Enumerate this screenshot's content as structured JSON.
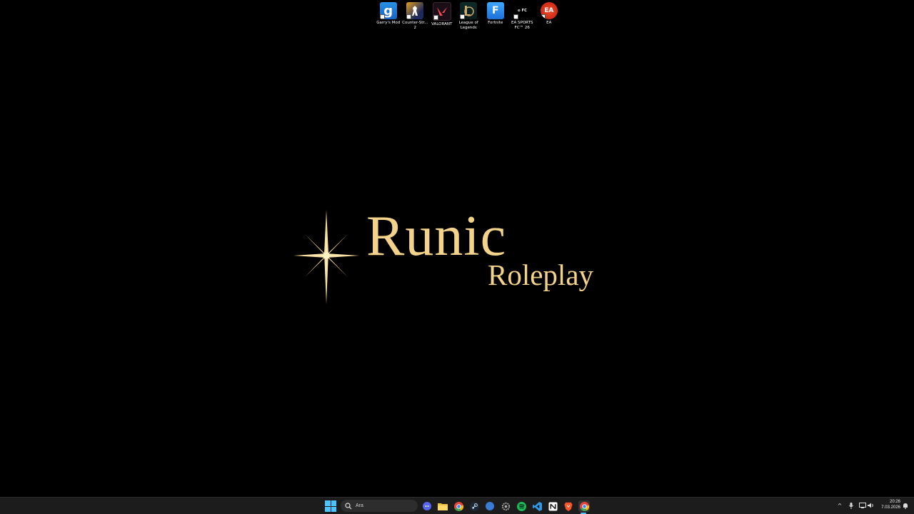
{
  "desktop": {
    "icons": [
      {
        "label": "Garry's Mod",
        "glyph": "g",
        "icon": "garrys-mod-icon"
      },
      {
        "label": "Counter-Str... 2",
        "glyph": "",
        "icon": "counter-strike-icon"
      },
      {
        "label": "VALORANT",
        "glyph": "V",
        "icon": "valorant-icon"
      },
      {
        "label": "League of Legends",
        "glyph": "L",
        "icon": "league-of-legends-icon"
      },
      {
        "label": "Fortnite",
        "glyph": "F",
        "icon": "fortnite-icon"
      },
      {
        "label": "EA SPORTS FC™ 26",
        "glyph": "⊙ FC",
        "icon": "ea-sports-fc-icon"
      },
      {
        "label": "EA",
        "glyph": "EA",
        "icon": "ea-icon"
      }
    ]
  },
  "wallpaper": {
    "title": "Runic",
    "subtitle": "Roleplay",
    "accent_color": "#f3d28a"
  },
  "taskbar": {
    "search_placeholder": "Ara",
    "apps": [
      {
        "name": "discord-icon",
        "color": "#5865f2"
      },
      {
        "name": "file-explorer-icon",
        "color": "#f0c040"
      },
      {
        "name": "chrome-icon",
        "color": "#ea4335"
      },
      {
        "name": "steam-icon",
        "color": "#1b2838"
      },
      {
        "name": "app-blue-icon",
        "color": "#3a7bd5"
      },
      {
        "name": "settings-gear-icon",
        "color": "#888888"
      },
      {
        "name": "spotify-icon",
        "color": "#1db954"
      },
      {
        "name": "vscode-icon",
        "color": "#2f9be8"
      },
      {
        "name": "notion-icon",
        "color": "#ffffff"
      },
      {
        "name": "brave-icon",
        "color": "#fb542b"
      },
      {
        "name": "chrome-active-icon",
        "color": "#ea4335"
      }
    ],
    "tray": {
      "time": "20:26",
      "date": "7.03.2026"
    }
  }
}
